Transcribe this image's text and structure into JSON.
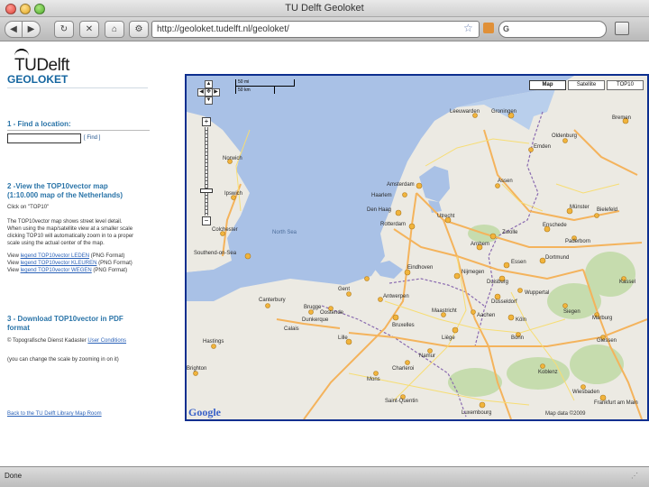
{
  "window": {
    "title": "TU Delft Geoloket"
  },
  "toolbar": {
    "url": "http://geoloket.tudelft.nl/geoloket/",
    "back_glyph": "◀",
    "forward_glyph": "▶",
    "reload_glyph": "↻",
    "stop_glyph": "✕",
    "home_glyph": "⌂",
    "tools_glyph": "⚙",
    "search_engine": "G",
    "icons": [
      "back-icon",
      "forward-icon",
      "reload-icon",
      "stop-icon",
      "home-icon",
      "star-icon",
      "rss-icon",
      "search-engine-icon",
      "bookmark-icon"
    ]
  },
  "sidebar": {
    "logo_tu": "TU",
    "logo_delft": "Delft",
    "app_title": "GEOLOKET",
    "sec1_title": "1 - Find a location:",
    "find_button": "[ Find ]",
    "sec2_title_1": "2 -View the TOP10vector map",
    "sec2_title_2": "(1:10.000 map of the Netherlands)",
    "sec2_click": "Click on \"TOP10\"",
    "sec2_p1": "The TOP10vector map shows street level detail.",
    "sec2_p2": "When using the map/satellite view at a smaller scale",
    "sec2_p3": "clicking TOP10 will automatically zoom in to a proper",
    "sec2_p4": "scale using the actual center of the map.",
    "legend_prefix": "View",
    "legend_1_link": "legend TOP10vector LEDEN",
    "legend_1_suffix": "(PNG Format)",
    "legend_2_link": "legend TOP10vector KLEUREN",
    "legend_2_suffix": "(PNG Format)",
    "legend_3_link": "legend TOP10vector WEGEN",
    "legend_3_suffix": "(PNG Format)",
    "sec3_title_1": "3 - Download TOP10vector in PDF",
    "sec3_title_2": "format",
    "sec3_copyright": "© Topografische Dienst Kadaster",
    "sec3_conditions_link": "User Conditions",
    "sec3_note": "(you can change the scale by zooming in on it)",
    "back_link": "Back to the TU Delft Library Map Room"
  },
  "map": {
    "type_map": "Map",
    "type_satellite": "Satellite",
    "type_top10": "TOP10",
    "selected_type": "Map",
    "scale_top": "50 mi",
    "scale_bottom": "50 km",
    "zoom_in_label": "+",
    "zoom_out_label": "−",
    "google_logo": "Google",
    "credit": "Map data ©2009",
    "cities": [
      "Bremen",
      "Oldenburg",
      "Groningen",
      "Leeuwarden",
      "Assen",
      "Emden",
      "Amsterdam",
      "Haarlem",
      "Den Haag",
      "Rotterdam",
      "Utrecht",
      "Zwolle",
      "Enschede",
      "Arnhem",
      "Nijmegen",
      "Eindhoven",
      "Antwerpen",
      "Gent",
      "Brugge",
      "Bruxelles",
      "Liège",
      "Lille",
      "Maastricht",
      "Essen",
      "Dortmund",
      "Duisburg",
      "Düsseldorf",
      "Köln",
      "Bonn",
      "Koblenz",
      "Aachen",
      "Wuppertal",
      "Münster",
      "Bielefeld",
      "Paderborn",
      "Kassel",
      "Siegen",
      "Marburg",
      "Giessen",
      "Luxembourg",
      "Namur",
      "Charleroi",
      "Mons",
      "Calais",
      "Dunkerque",
      "Oostende",
      "Saint-Quentin",
      "Wiesbaden",
      "Frankfurt am Main",
      "Southend-on-Sea",
      "Norwich",
      "Ipswich",
      "Colchester",
      "Canterbury",
      "Hastings",
      "Brighton"
    ],
    "seas": [
      "North Sea"
    ],
    "colors": {
      "land": "#eceae3",
      "water": "#a9c1e6",
      "forest": "#c6dcae",
      "motorway": "#f4b35c",
      "road": "#f7dd73",
      "border": "#8a6ab0",
      "frame": "#0d2f8f"
    }
  },
  "status": {
    "text": "Done"
  }
}
